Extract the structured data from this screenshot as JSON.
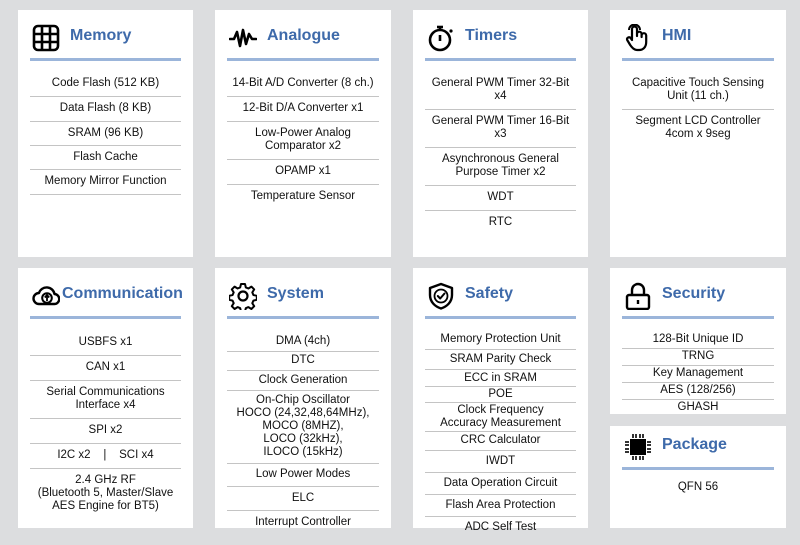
{
  "colors": {
    "background": "#dcdddf",
    "card": "#ffffff",
    "title": "#3e6aaa",
    "underline": "#9bb5da",
    "divider": "#c4c4c4"
  },
  "cards": {
    "memory": {
      "icon": "grid-icon",
      "title": "Memory",
      "items": [
        "Code Flash (512 KB)",
        "Data Flash (8 KB)",
        "SRAM (96 KB)",
        "Flash Cache",
        "Memory Mirror Function"
      ]
    },
    "analogue": {
      "icon": "waveform-icon",
      "title": "Analogue",
      "items": [
        "14-Bit A/D Converter (8 ch.)",
        "12-Bit D/A Converter x1",
        "Low-Power Analog\nComparator x2",
        "OPAMP x1",
        "Temperature Sensor"
      ]
    },
    "timers": {
      "icon": "stopwatch-icon",
      "title": "Timers",
      "items": [
        "General PWM Timer 32-Bit x4",
        "General PWM Timer 16-Bit x3",
        "Asynchronous General\nPurpose Timer x2",
        "WDT",
        "RTC"
      ]
    },
    "hmi": {
      "icon": "touch-hand-icon",
      "title": "HMI",
      "items": [
        "Capacitive Touch Sensing\nUnit (11 ch.)",
        "Segment LCD Controller\n4com x 9seg"
      ]
    },
    "communication": {
      "icon": "cloud-upload-icon",
      "title": "Communication",
      "items": [
        "USBFS x1",
        "CAN x1",
        "Serial Communications\nInterface x4",
        "SPI x2",
        "I2C x2    |    SCI x4",
        "2.4 GHz RF\n(Bluetooth 5, Master/Slave\nAES Engine for BT5)"
      ]
    },
    "system": {
      "icon": "gear-icon",
      "title": "System",
      "items": [
        "DMA (4ch)",
        "DTC",
        "Clock Generation",
        "On-Chip Oscillator\nHOCO (24,32,48,64MHz),\nMOCO (8MHZ),\nLOCO (32kHz),\nILOCO (15kHz)",
        "Low Power Modes",
        "ELC",
        "Interrupt Controller"
      ]
    },
    "safety": {
      "icon": "shield-check-icon",
      "title": "Safety",
      "items": [
        "Memory Protection Unit",
        "SRAM Parity Check",
        "ECC in SRAM",
        "POE",
        "Clock Frequency\nAccuracy Measurement",
        "CRC Calculator",
        "IWDT",
        "Data Operation Circuit",
        "Flash Area Protection",
        "ADC Self Test"
      ]
    },
    "security": {
      "icon": "padlock-icon",
      "title": "Security",
      "items": [
        "128-Bit Unique ID",
        "TRNG",
        "Key Management",
        "AES (128/256)",
        "GHASH"
      ]
    },
    "package": {
      "icon": "chip-icon",
      "title": "Package",
      "items": [
        "QFN 56"
      ]
    }
  }
}
